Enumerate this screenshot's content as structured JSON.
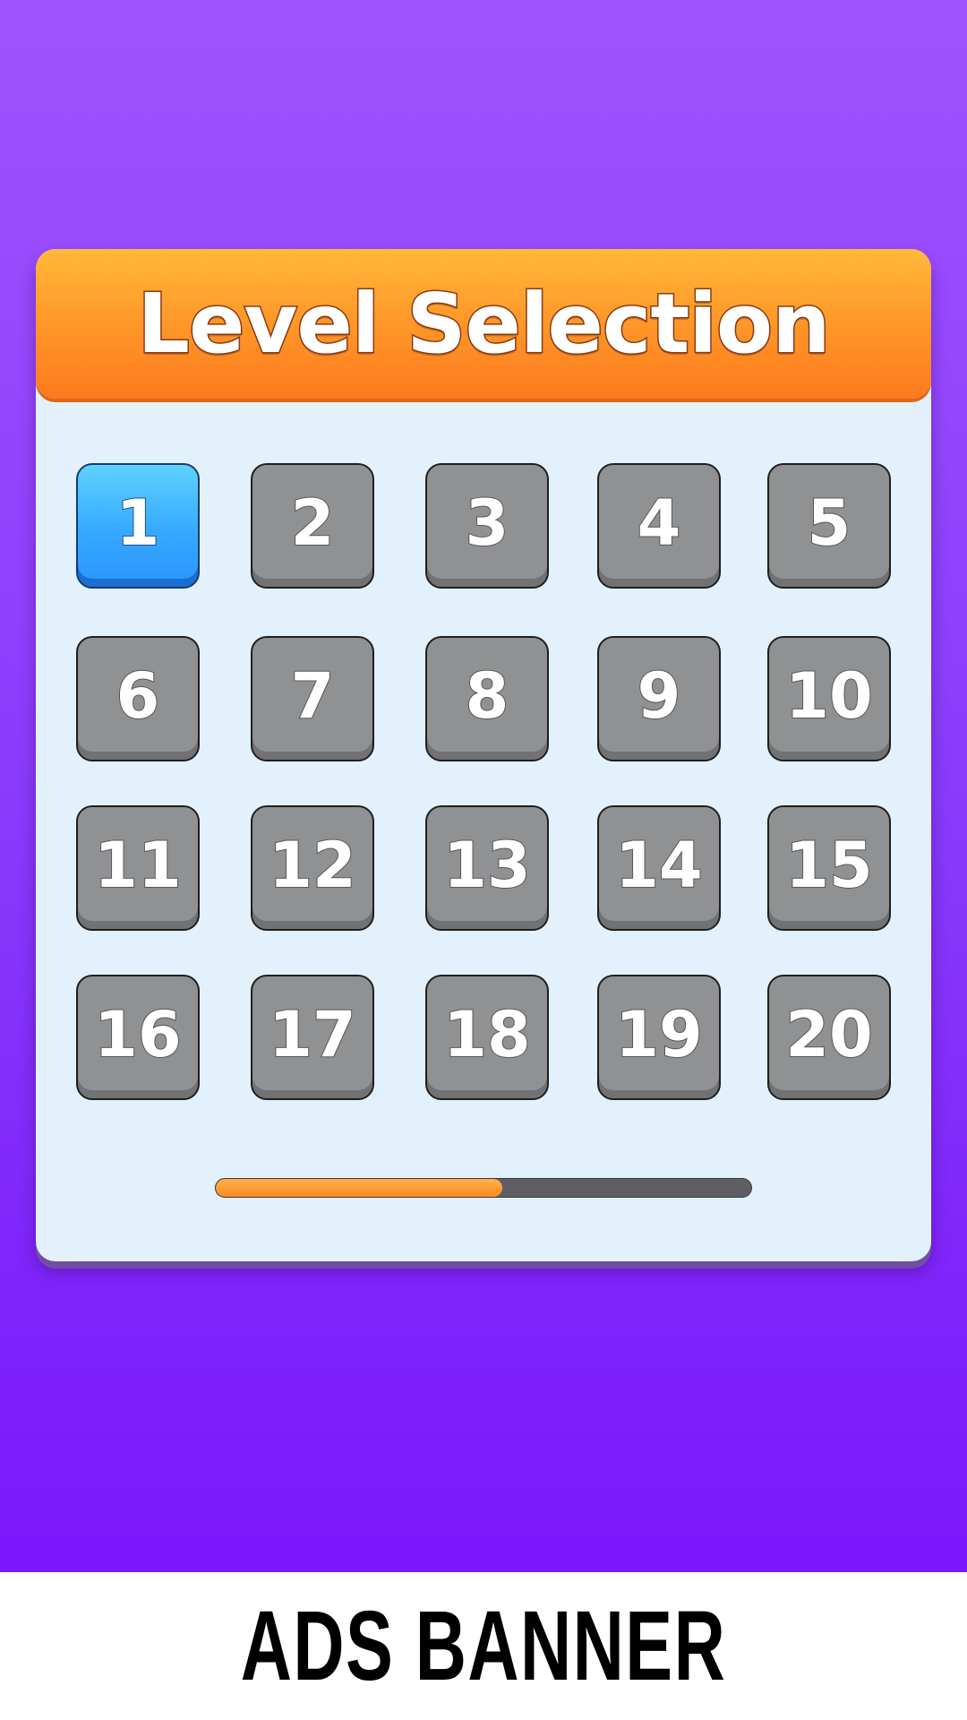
{
  "header": {
    "title": "Level Selection"
  },
  "levels": [
    {
      "label": "1",
      "state": "current"
    },
    {
      "label": "2",
      "state": "locked"
    },
    {
      "label": "3",
      "state": "locked"
    },
    {
      "label": "4",
      "state": "locked"
    },
    {
      "label": "5",
      "state": "locked"
    },
    {
      "label": "6",
      "state": "locked"
    },
    {
      "label": "7",
      "state": "locked"
    },
    {
      "label": "8",
      "state": "locked"
    },
    {
      "label": "9",
      "state": "locked"
    },
    {
      "label": "10",
      "state": "locked"
    },
    {
      "label": "11",
      "state": "locked"
    },
    {
      "label": "12",
      "state": "locked"
    },
    {
      "label": "13",
      "state": "locked"
    },
    {
      "label": "14",
      "state": "locked"
    },
    {
      "label": "15",
      "state": "locked"
    },
    {
      "label": "16",
      "state": "locked"
    },
    {
      "label": "17",
      "state": "locked"
    },
    {
      "label": "18",
      "state": "locked"
    },
    {
      "label": "19",
      "state": "locked"
    },
    {
      "label": "20",
      "state": "locked"
    }
  ],
  "progress": {
    "fraction": 0.535
  },
  "ads": {
    "label": "ADS BANNER"
  },
  "colors": {
    "background_top": "#a052fe",
    "background_bottom": "#7a17fb",
    "header_orange": "#fd8a22",
    "active_level_blue": "#37a8ff",
    "locked_level_gray": "#8f9193",
    "panel": "#e2f1fc"
  }
}
